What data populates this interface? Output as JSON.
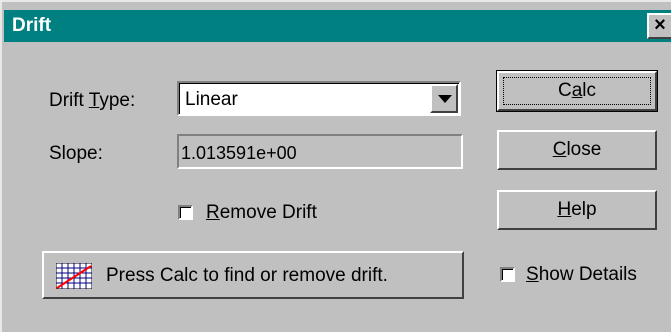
{
  "window": {
    "title": "Drift",
    "close_glyph": "×"
  },
  "drift_type": {
    "label_pre": "Drift ",
    "label_mnemonic": "T",
    "label_post": "ype:",
    "selected_value": "Linear"
  },
  "slope": {
    "label": "Slope:",
    "value": "1.013591e+00"
  },
  "remove_drift": {
    "mnemonic": "R",
    "label_rest": "emove Drift",
    "checked": false
  },
  "buttons": {
    "calc": {
      "pre": "C",
      "mnemonic": "a",
      "post": "lc"
    },
    "close": {
      "pre": "",
      "mnemonic": "C",
      "post": "lose"
    },
    "help": {
      "pre": "",
      "mnemonic": "H",
      "post": "elp"
    }
  },
  "status": {
    "icon": "grid-chart-icon",
    "message": "Press Calc to find or remove drift."
  },
  "show_details": {
    "mnemonic": "S",
    "label_rest": "how Details",
    "checked": false
  },
  "colors": {
    "titlebar": "#008080",
    "face": "#c0c0c0"
  }
}
